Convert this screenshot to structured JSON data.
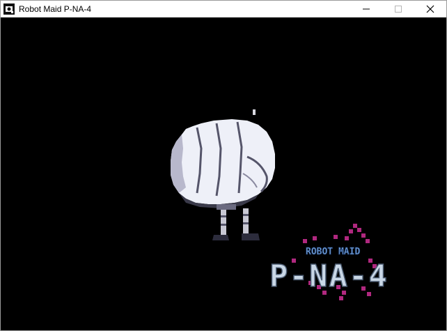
{
  "window": {
    "title": "Robot Maid P-NA-4",
    "icon": "game-app-icon",
    "controls": {
      "minimize_icon": "minimize-icon",
      "maximize_icon": "maximize-icon",
      "close_icon": "close-icon"
    }
  },
  "game": {
    "background_color": "#000000",
    "character": "fist-headed-robot-sprite",
    "logo": {
      "top_text": "ROBOT MAID",
      "main_text": "P-NA-4",
      "top_text_color": "#7fb0e8",
      "main_text_color": "#c9d7e6",
      "accent_color": "#b0287f"
    }
  }
}
